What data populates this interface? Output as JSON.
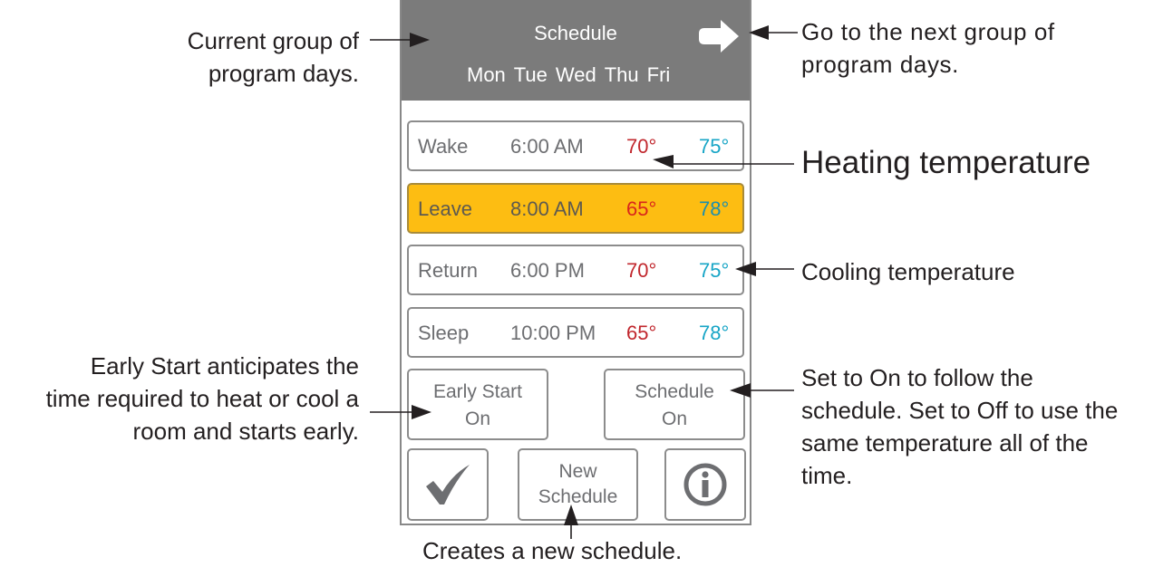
{
  "device": {
    "header": {
      "title": "Schedule",
      "days": [
        "Mon",
        "Tue",
        "Wed",
        "Thu",
        "Fri"
      ],
      "next_icon": "right-arrow-icon"
    },
    "rows": [
      {
        "period": "Wake",
        "time": "6:00 AM",
        "heat": "70°",
        "cool": "75°",
        "selected": false
      },
      {
        "period": "Leave",
        "time": "8:00 AM",
        "heat": "65°",
        "cool": "78°",
        "selected": true
      },
      {
        "period": "Return",
        "time": "6:00 PM",
        "heat": "70°",
        "cool": "75°",
        "selected": false
      },
      {
        "period": "Sleep",
        "time": "10:00 PM",
        "heat": "65°",
        "cool": "78°",
        "selected": false
      }
    ],
    "early_start": {
      "line1": "Early Start",
      "line2": "On"
    },
    "schedule_toggle": {
      "line1": "Schedule",
      "line2": "On"
    },
    "confirm_icon": "checkmark-icon",
    "new_schedule": {
      "line1": "New",
      "line2": "Schedule"
    },
    "info_icon": "info-icon"
  },
  "annotations": {
    "current_group": [
      "Current group of",
      "program days."
    ],
    "next_group": [
      "Go to the next group of",
      "program days."
    ],
    "heating": "Heating temperature",
    "cooling": "Cooling temperature",
    "early_start": [
      "Early Start anticipates the",
      "time required to heat or cool a",
      "room and starts early."
    ],
    "schedule": [
      "Set to On to follow the",
      "schedule. Set to Off to use the",
      "same temperature all of the",
      "time."
    ],
    "new_schedule": "Creates a new schedule."
  },
  "colors": {
    "header": "#7b7b7b",
    "selected_row": "#fdbd12",
    "heat": "#c1272d",
    "cool": "#17a5c6"
  }
}
